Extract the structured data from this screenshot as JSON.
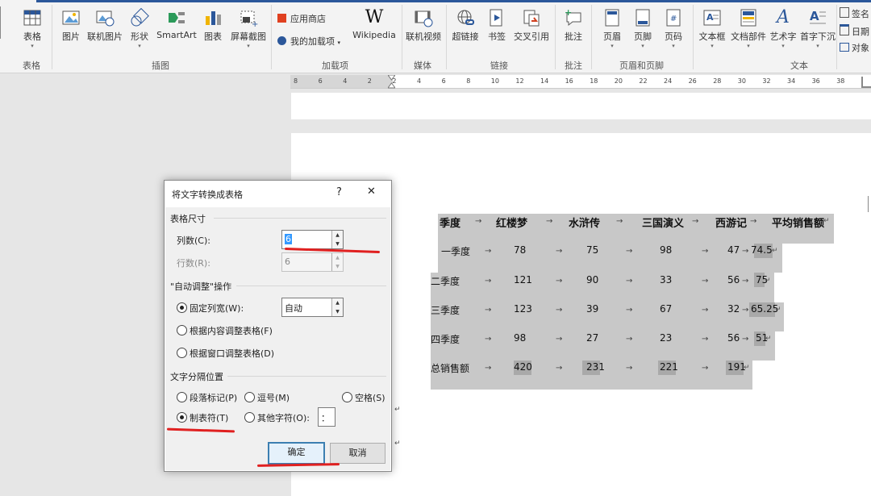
{
  "ribbon": {
    "groups": {
      "table": "表格",
      "illustrations": "插图",
      "addins": "加载项",
      "media": "媒体",
      "links": "链接",
      "comments": "批注",
      "header_footer": "页眉和页脚",
      "text": "文本"
    },
    "buttons": {
      "table": "表格",
      "picture": "图片",
      "online_picture": "联机图片",
      "shapes": "形状",
      "smartart": "SmartArt",
      "chart": "图表",
      "screenshot": "屏幕截图",
      "store": "应用商店",
      "my_addins": "我的加载项",
      "wikipedia": "Wikipedia",
      "online_video": "联机视频",
      "hyperlink": "超链接",
      "bookmark": "书签",
      "crossref": "交叉引用",
      "comment": "批注",
      "header": "页眉",
      "footer": "页脚",
      "page_number": "页码",
      "textbox": "文本框",
      "quick_parts": "文档部件",
      "wordart": "艺术字",
      "dropcap": "首字下沉",
      "signature": "签名",
      "datetime": "日期",
      "object": "对象"
    }
  },
  "ruler": {
    "ticks": [
      "8",
      "6",
      "4",
      "2",
      "2",
      "4",
      "6",
      "8",
      "10",
      "12",
      "14",
      "16",
      "18",
      "20",
      "22",
      "24",
      "26",
      "28",
      "30",
      "32",
      "34",
      "36",
      "38"
    ]
  },
  "document": {
    "table_header": [
      "季度",
      "红楼梦",
      "水浒传",
      "三国演义",
      "西游记",
      "平均销售额"
    ],
    "rows": [
      [
        "一季度",
        "78",
        "75",
        "98",
        "47",
        "74.5"
      ],
      [
        "二季度",
        "121",
        "90",
        "33",
        "56",
        "75"
      ],
      [
        "三季度",
        "123",
        "39",
        "67",
        "32",
        "65.25"
      ],
      [
        "四季度",
        "98",
        "27",
        "23",
        "56",
        "51"
      ],
      [
        "总销售额",
        "420",
        "231",
        "221",
        "191",
        ""
      ]
    ]
  },
  "dialog": {
    "title": "将文字转换成表格",
    "help": "?",
    "close": "✕",
    "section_size": "表格尺寸",
    "cols_label": "列数(C):",
    "cols_value": "6",
    "rows_label": "行数(R):",
    "rows_value": "6",
    "section_autofit": "\"自动调整\"操作",
    "fixed_width": "固定列宽(W):",
    "fixed_width_value": "自动",
    "autofit_content": "根据内容调整表格(F)",
    "autofit_window": "根据窗口调整表格(D)",
    "section_separator": "文字分隔位置",
    "sep_paragraph": "段落标记(P)",
    "sep_comma": "逗号(M)",
    "sep_space": "空格(S)",
    "sep_tab": "制表符(T)",
    "sep_other": "其他字符(O):",
    "sep_other_value": "：",
    "ok": "确定",
    "cancel": "取消"
  },
  "colors": {
    "accent": "#2b579a",
    "annotation": "#e02020",
    "selection": "#c8c8c8"
  }
}
